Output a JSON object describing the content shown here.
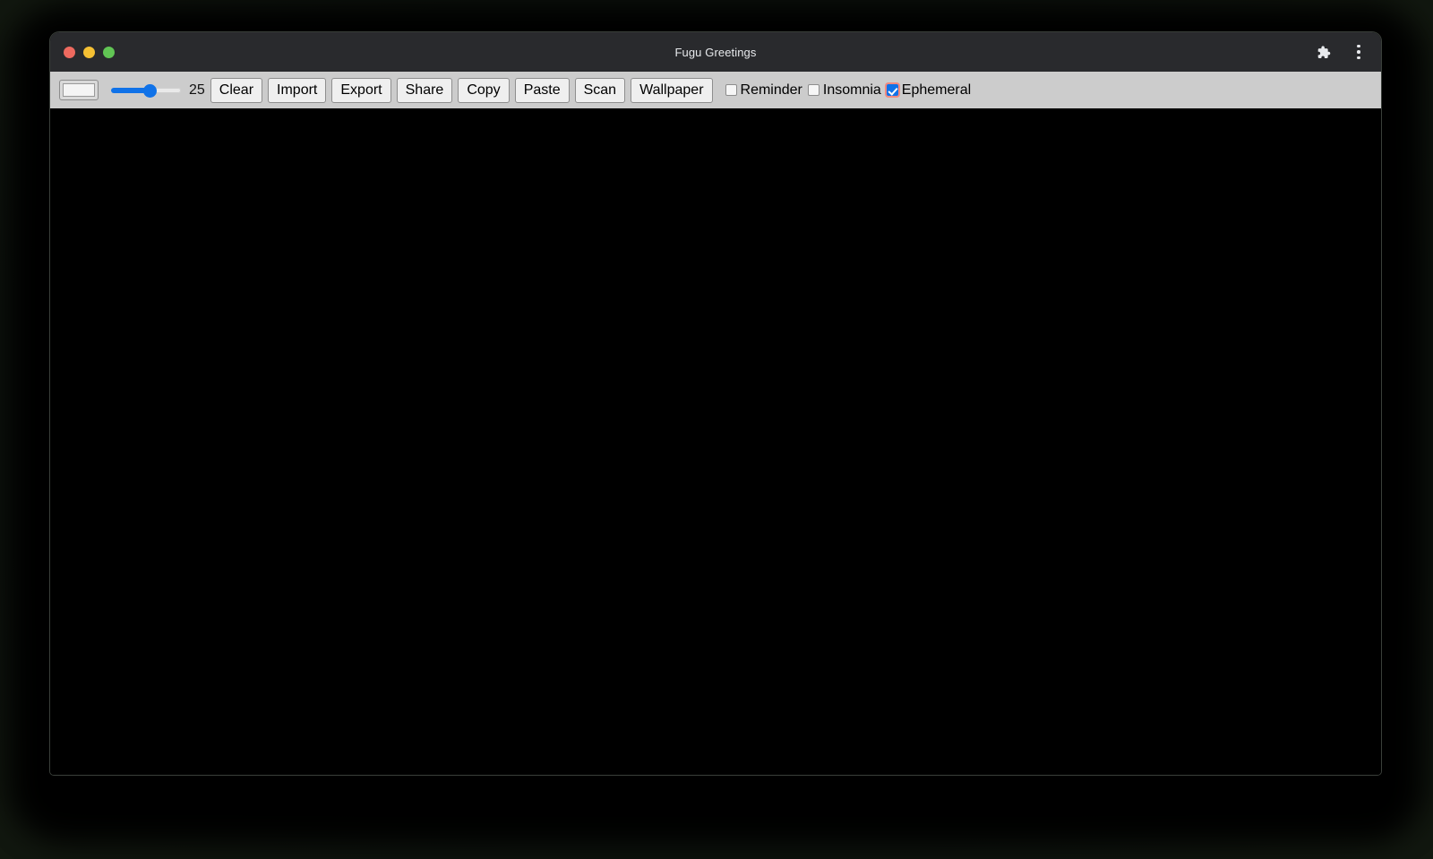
{
  "window": {
    "title": "Fugu Greetings",
    "traffic_lights": [
      {
        "name": "close",
        "color": "#ee6a5f"
      },
      {
        "name": "minimize",
        "color": "#f5c033"
      },
      {
        "name": "maximize",
        "color": "#61c554"
      }
    ],
    "actions": [
      {
        "name": "extensions-icon",
        "label": "Extensions"
      },
      {
        "name": "chrome-menu-icon",
        "label": "Customize and control"
      }
    ]
  },
  "toolbar": {
    "color_picker": {
      "value": "#ffffff"
    },
    "slider": {
      "value": 25,
      "min": 0,
      "max": 50,
      "percent": 55,
      "accent": "#1072e8"
    },
    "slider_value_label": "25",
    "buttons": [
      {
        "name": "clear-button",
        "label": "Clear"
      },
      {
        "name": "import-button",
        "label": "Import"
      },
      {
        "name": "export-button",
        "label": "Export"
      },
      {
        "name": "share-button",
        "label": "Share"
      },
      {
        "name": "copy-button",
        "label": "Copy"
      },
      {
        "name": "paste-button",
        "label": "Paste"
      },
      {
        "name": "scan-button",
        "label": "Scan"
      },
      {
        "name": "wallpaper-button",
        "label": "Wallpaper"
      }
    ],
    "checkboxes": [
      {
        "name": "reminder-checkbox",
        "label": "Reminder",
        "checked": false
      },
      {
        "name": "insomnia-checkbox",
        "label": "Insomnia",
        "checked": false
      },
      {
        "name": "ephemeral-checkbox",
        "label": "Ephemeral",
        "checked": true,
        "focus_ring": "#f08a80"
      }
    ]
  },
  "canvas": {
    "background": "#000000",
    "content": ""
  }
}
